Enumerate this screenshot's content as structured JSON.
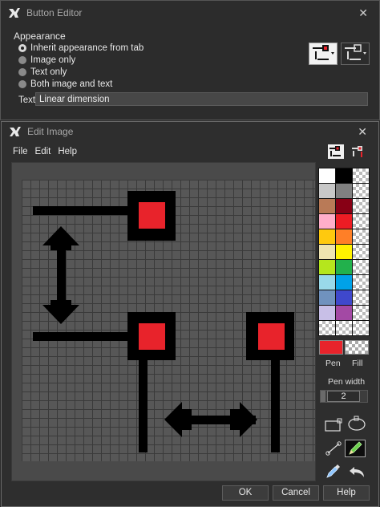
{
  "button_editor": {
    "title": "Button Editor",
    "close_glyph": "✕",
    "appearance_label": "Appearance",
    "options": [
      {
        "label": "Inherit appearance from tab",
        "checked": true
      },
      {
        "label": "Image only",
        "checked": false
      },
      {
        "label": "Text only",
        "checked": false
      },
      {
        "label": "Both image and text",
        "checked": false
      }
    ],
    "text_label": "Text:",
    "text_value": "Linear dimension"
  },
  "edit_image": {
    "title": "Edit Image",
    "close_glyph": "✕",
    "menu": [
      "File",
      "Edit",
      "Help"
    ],
    "palette": [
      "#ffffff",
      "#000000",
      "checker",
      "#c8c8c8",
      "#808080",
      "checker",
      "#b97a57",
      "#880015",
      "checker",
      "#ffaec9",
      "#ed1c24",
      "checker",
      "#ffc90e",
      "#ff7f27",
      "checker",
      "#efe4b0",
      "#fff200",
      "checker",
      "#b5e61d",
      "#22b14c",
      "checker",
      "#99d9ea",
      "#00a2e8",
      "checker",
      "#7092be",
      "#3f48cc",
      "checker",
      "#c8bfe7",
      "#a349a4",
      "checker",
      "checker",
      "checker",
      "checker"
    ],
    "pen_label": "Pen",
    "fill_label": "Fill",
    "pen_color": "#e8232b",
    "pen_width_label": "Pen width",
    "pen_width": "2",
    "buttons": {
      "ok": "OK",
      "cancel": "Cancel",
      "help": "Help"
    },
    "tools": [
      "rectangle-tool-icon",
      "ellipse-tool-icon",
      "line-tool-icon",
      "pencil-tool-icon",
      "eyedropper-icon",
      "undo-icon"
    ]
  }
}
